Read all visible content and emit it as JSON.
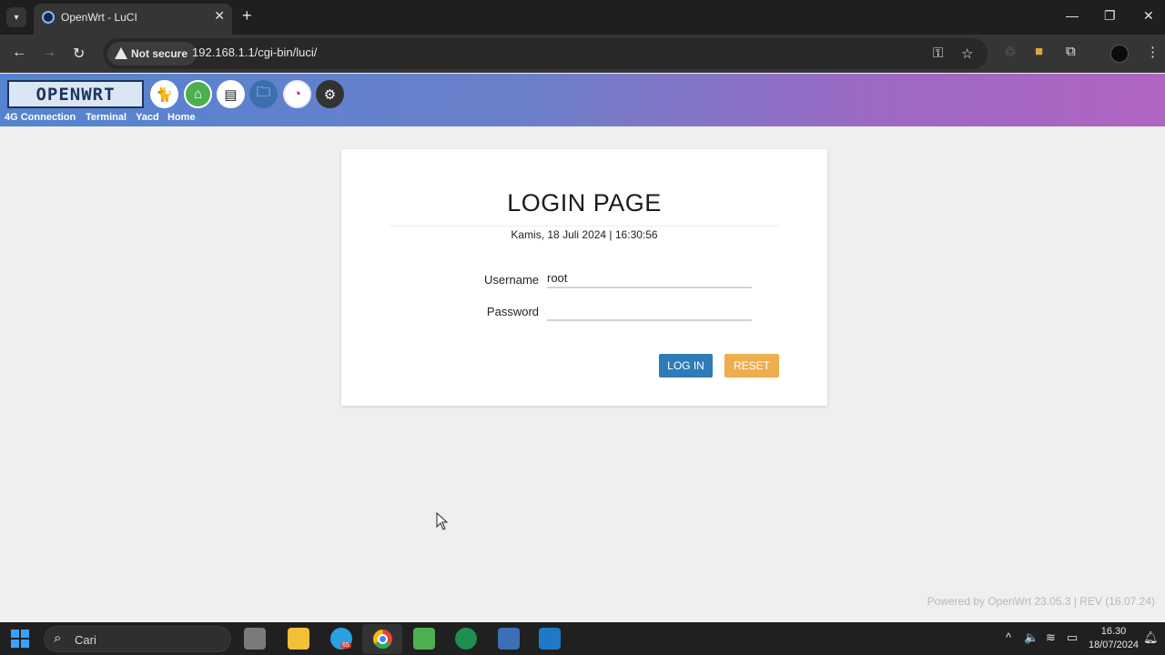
{
  "browser": {
    "tab_title": "OpenWrt - LuCI",
    "security_label": "Not secure",
    "url": "192.168.1.1/cgi-bin/luci/"
  },
  "header": {
    "logo_text": "OPENWRT",
    "menu_links": [
      "4G Connection",
      "Terminal",
      "Yacd",
      "Home"
    ]
  },
  "login": {
    "title": "LOGIN PAGE",
    "datetime": "Kamis, 18 Juli 2024 | 16:30:56",
    "username_label": "Username",
    "username_value": "root",
    "password_label": "Password",
    "password_value": "",
    "login_button": "LOG IN",
    "reset_button": "RESET"
  },
  "footer": {
    "powered_by": "Powered by OpenWrt 23.05.3 | REV (16.07.24)"
  },
  "taskbar": {
    "search_placeholder": "Cari",
    "telegram_badge": "65",
    "time": "16.30",
    "date": "18/07/2024"
  },
  "colors": {
    "login_button": "#2f7bb8",
    "reset_button": "#ecae4e",
    "header_gradient_start": "#5484cf",
    "header_gradient_end": "#b064c2"
  }
}
